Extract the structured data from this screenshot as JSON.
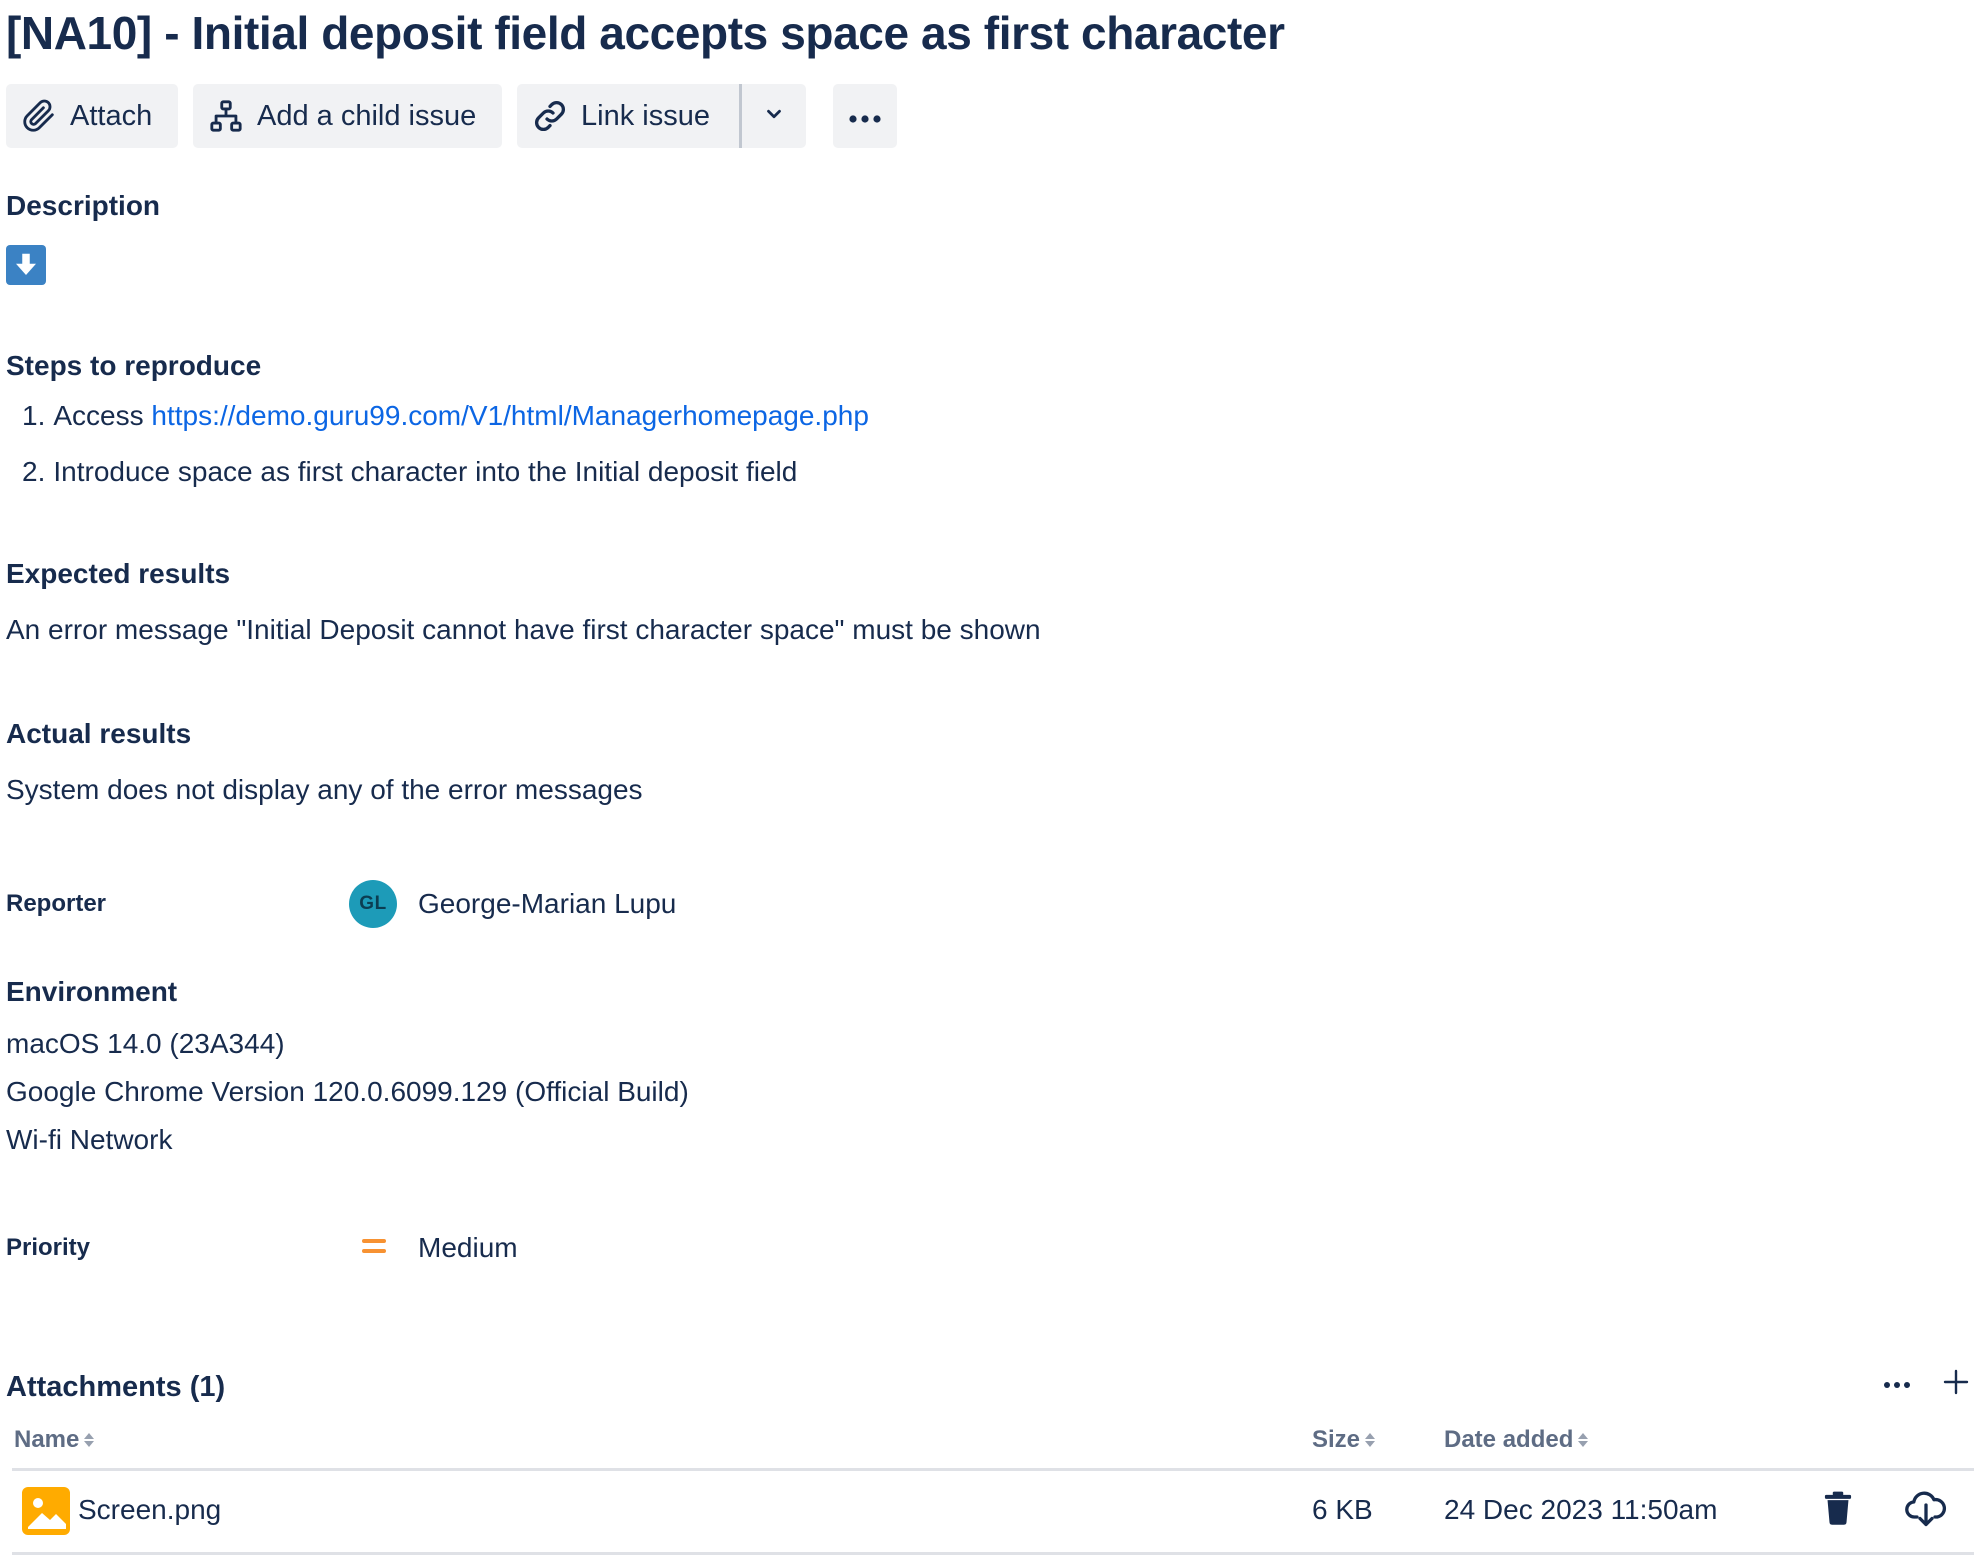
{
  "issue": {
    "title": "[NA10] - Initial deposit field accepts space as first character"
  },
  "toolbar": {
    "attach_label": "Attach",
    "attach_icon": "paperclip-icon",
    "child_label": "Add a child issue",
    "child_icon": "hierarchy-icon",
    "link_label": "Link issue",
    "link_icon": "link-icon",
    "link_more_icon": "chevron-down-icon",
    "more_icon": "more-horizontal-icon"
  },
  "description": {
    "heading": "Description",
    "emoji_icon": "arrow-down-emoji-icon",
    "steps_heading": "Steps to reproduce",
    "steps": [
      {
        "number": "1.",
        "prefix": "Access ",
        "link": "https://demo.guru99.com/V1/html/Managerhomepage.php"
      },
      {
        "number": "2.",
        "text": "Introduce space as first character into the Initial deposit field"
      }
    ],
    "expected_heading": "Expected results",
    "expected_text": "An error message \"Initial Deposit cannot have first character space\" must be shown",
    "actual_heading": "Actual results",
    "actual_text": "System does not display any of the error messages"
  },
  "reporter": {
    "label": "Reporter",
    "initials": "GL",
    "name": "George-Marian Lupu",
    "avatar_color": "#1d9bb8"
  },
  "environment": {
    "heading": "Environment",
    "lines": [
      "macOS 14.0 (23A344)",
      "Google Chrome Version 120.0.6099.129 (Official Build)",
      "Wi-fi Network"
    ]
  },
  "priority": {
    "label": "Priority",
    "value": "Medium",
    "icon": "priority-medium-icon",
    "color": "#f79232"
  },
  "attachments": {
    "heading": "Attachments (1)",
    "more_icon": "more-horizontal-icon",
    "add_icon": "plus-icon",
    "columns": {
      "name": "Name",
      "size": "Size",
      "date": "Date added"
    },
    "rows": [
      {
        "thumb_icon": "image-file-icon",
        "name": "Screen.png",
        "size": "6 KB",
        "date": "24 Dec 2023 11:50am",
        "delete_icon": "trash-icon",
        "download_icon": "cloud-download-icon"
      }
    ]
  },
  "colors": {
    "text": "#172b4d",
    "link": "#0c66e4",
    "subtle_text": "#5e6c84",
    "button_bg": "#f1f2f4",
    "thumb_bg": "#ffab00",
    "emoji_bg": "#3b82c4"
  }
}
